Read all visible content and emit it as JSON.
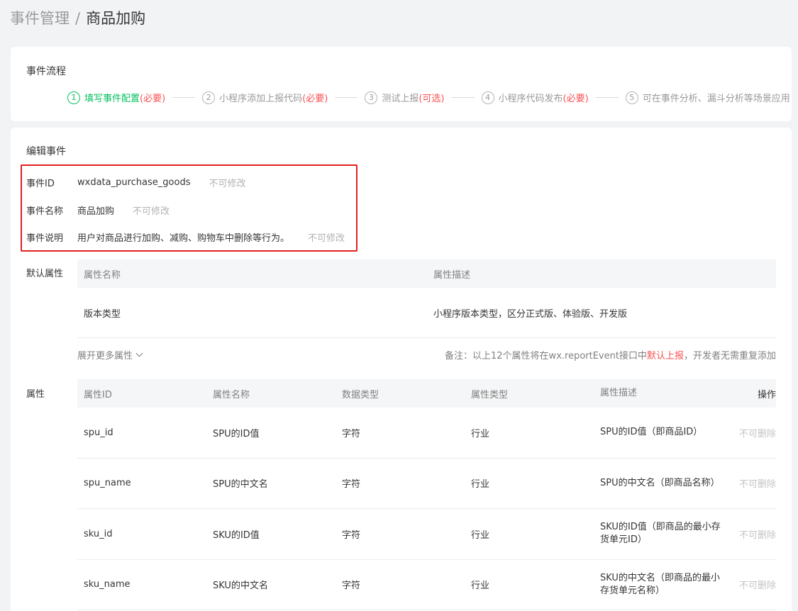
{
  "breadcrumb": {
    "parent": "事件管理",
    "separator": "/",
    "current": "商品加购"
  },
  "flow": {
    "title": "事件流程",
    "steps": [
      {
        "num": "1",
        "label": "填写事件配置 ",
        "tag": "(必要)"
      },
      {
        "num": "2",
        "label": "小程序添加上报代码",
        "tag": "(必要)"
      },
      {
        "num": "3",
        "label": "测试上报",
        "tag": "(可选)"
      },
      {
        "num": "4",
        "label": "小程序代码发布",
        "tag": "(必要)"
      },
      {
        "num": "5",
        "label": "可在事件分析、漏斗分析等场景应用",
        "tag": ""
      }
    ]
  },
  "edit": {
    "title": "编辑事件",
    "event_id": {
      "label": "事件ID",
      "value": "wxdata_purchase_goods",
      "note": "不可修改"
    },
    "event_name": {
      "label": "事件名称",
      "value": "商品加购",
      "note": "不可修改"
    },
    "event_desc": {
      "label": "事件说明",
      "value": "用户对商品进行加购、减购、购物车中删除等行为。",
      "note": "不可修改"
    }
  },
  "default_attrs": {
    "label": "默认属性",
    "headers": [
      "属性名称",
      "属性描述"
    ],
    "rows": [
      {
        "name": "版本类型",
        "desc": "小程序版本类型，区分正式版、体验版、开发版"
      }
    ],
    "expand_label": "展开更多属性",
    "remark_prefix": "备注：以上12个属性将在wx.reportEvent接口中",
    "remark_highlight": "默认上报",
    "remark_suffix": "，开发者无需重复添加"
  },
  "attrs": {
    "label": "属性",
    "headers": [
      "属性ID",
      "属性名称",
      "数据类型",
      "属性类型",
      "属性描述",
      "操作"
    ],
    "rows": [
      {
        "id": "spu_id",
        "name": "SPU的ID值",
        "type": "字符",
        "category": "行业",
        "desc": "SPU的ID值（即商品ID）",
        "action": "不可删除"
      },
      {
        "id": "spu_name",
        "name": "SPU的中文名",
        "type": "字符",
        "category": "行业",
        "desc": "SPU的中文名（即商品名称）",
        "action": "不可删除"
      },
      {
        "id": "sku_id",
        "name": "SKU的ID值",
        "type": "字符",
        "category": "行业",
        "desc": "SKU的ID值（即商品的最小存货单元ID）",
        "action": "不可删除"
      },
      {
        "id": "sku_name",
        "name": "SKU的中文名",
        "type": "字符",
        "category": "行业",
        "desc": "SKU的中文名（即商品的最小存货单元名称）",
        "action": "不可删除"
      }
    ]
  },
  "colors": {
    "accent": "#07c160",
    "required": "#fa5151",
    "highlight_box": "#e02020"
  }
}
